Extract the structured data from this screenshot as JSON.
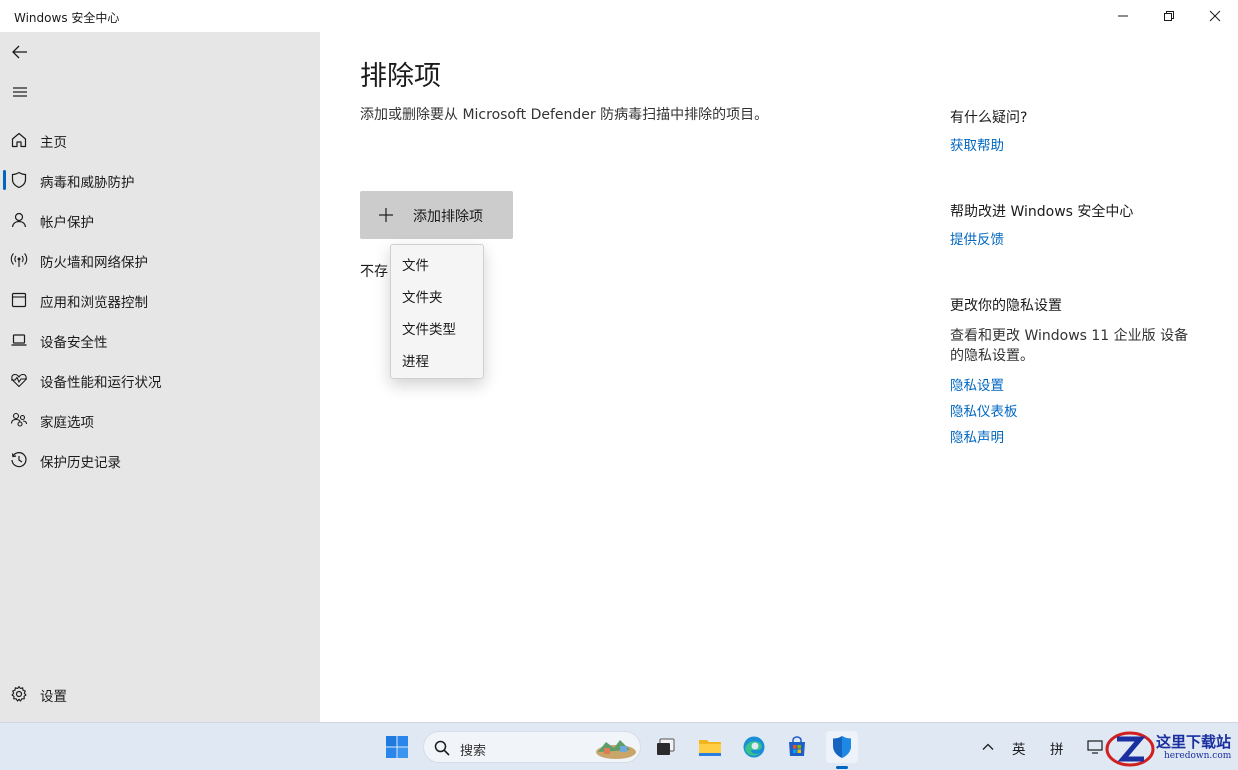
{
  "window": {
    "title": "Windows 安全中心"
  },
  "sidebar": {
    "items": [
      {
        "label": "主页",
        "icon": "home-icon",
        "selected": false
      },
      {
        "label": "病毒和威胁防护",
        "icon": "shield-icon",
        "selected": true
      },
      {
        "label": "帐户保护",
        "icon": "person-icon",
        "selected": false
      },
      {
        "label": "防火墙和网络保护",
        "icon": "wireless-icon",
        "selected": false
      },
      {
        "label": "应用和浏览器控制",
        "icon": "app-window-icon",
        "selected": false
      },
      {
        "label": "设备安全性",
        "icon": "laptop-icon",
        "selected": false
      },
      {
        "label": "设备性能和运行状况",
        "icon": "heart-pulse-icon",
        "selected": false
      },
      {
        "label": "家庭选项",
        "icon": "family-icon",
        "selected": false
      },
      {
        "label": "保护历史记录",
        "icon": "history-icon",
        "selected": false
      }
    ],
    "settings_label": "设置"
  },
  "main": {
    "title": "排除项",
    "description": "添加或删除要从 Microsoft Defender 防病毒扫描中排除的项目。",
    "add_button_label": "添加排除项",
    "under_text": "不存",
    "menu": [
      "文件",
      "文件夹",
      "文件类型",
      "进程"
    ]
  },
  "aside": {
    "help_heading": "有什么疑问?",
    "help_link": "获取帮助",
    "improve_heading": "帮助改进 Windows 安全中心",
    "improve_link": "提供反馈",
    "privacy_heading": "更改你的隐私设置",
    "privacy_text": "查看和更改 Windows 11 企业版 设备的隐私设置。",
    "privacy_links": [
      "隐私设置",
      "隐私仪表板",
      "隐私声明"
    ]
  },
  "taskbar": {
    "search_label": "搜索",
    "ime_lang": "英",
    "ime_mode": "拼",
    "watermark_main": "这里下载站",
    "watermark_url": "heredown.com"
  },
  "colors": {
    "accent": "#0067c0",
    "sidebar_bg": "#e6e6e6",
    "button_bg": "#cccccc"
  }
}
